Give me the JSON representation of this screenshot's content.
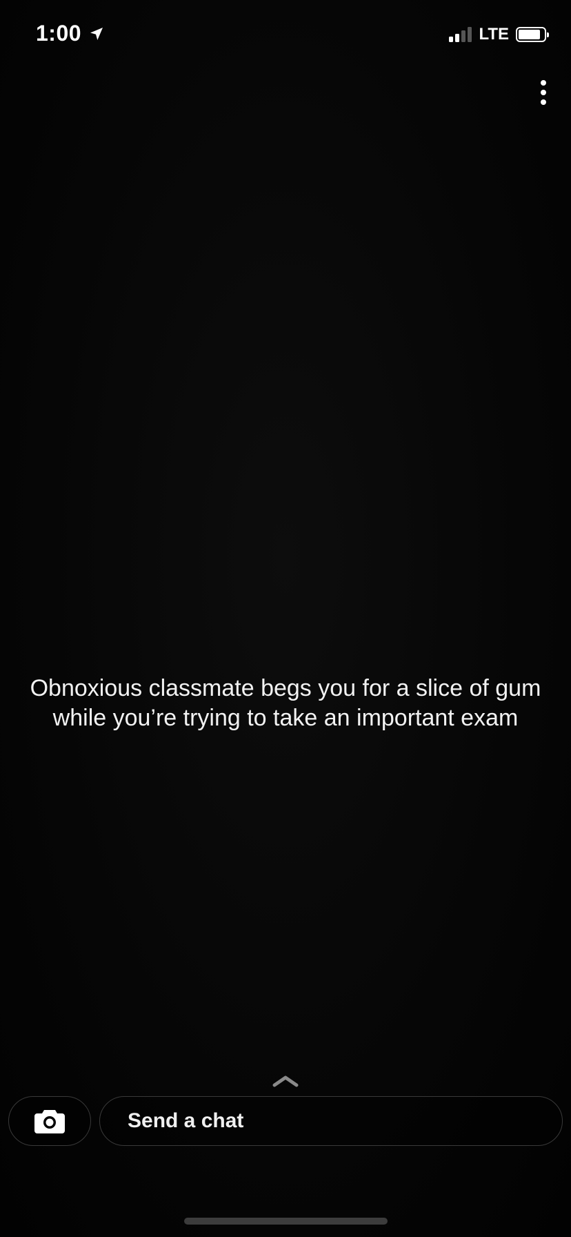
{
  "status_bar": {
    "time": "1:00",
    "network": "LTE",
    "signal_bars_filled": 2,
    "signal_bars_total": 4,
    "battery_level": 0.86
  },
  "story": {
    "caption": "Obnoxious classmate begs you for a slice of gum while you’re trying to take an important exam"
  },
  "chat_bar": {
    "placeholder": "Send a chat"
  },
  "icons": {
    "location": "location-arrow-icon",
    "more": "more-vertical-icon",
    "chevron": "chevron-up-icon",
    "camera": "camera-icon"
  },
  "colors": {
    "background": "#000000",
    "text": "#ffffff",
    "border": "#3a3a3a"
  }
}
